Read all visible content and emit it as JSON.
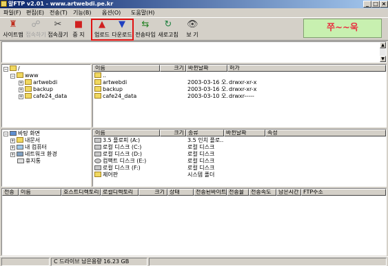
{
  "window": {
    "title": "알FTP v2.01 - www.artwebdi.pe.kr"
  },
  "menu": [
    "파일(F)",
    "편집(E)",
    "전송(T)",
    "기능(B)",
    "옵션(O)",
    "도움말(H)"
  ],
  "toolbar": {
    "site_manager": "사이트맵",
    "connect": "접속하기",
    "disconnect": "접속끊기",
    "stop": "중 지",
    "upload": "업로드",
    "download": "다운로드",
    "transfer_type": "전송타입",
    "refresh": "새로고침",
    "view": "보 기"
  },
  "logo_text": "쭈~~욱",
  "remote": {
    "tree": {
      "root": "/",
      "www": "www",
      "items": [
        "artwebdi",
        "backup",
        "cafe24_data"
      ]
    },
    "columns": [
      "이름",
      "크기",
      "바뀐날짜",
      "허가"
    ],
    "rows": [
      {
        "name": "..",
        "size": "",
        "date": "",
        "perm": ""
      },
      {
        "name": "artwebdi",
        "size": "",
        "date": "2003-03-16 오...",
        "perm": "drwxr-xr-x"
      },
      {
        "name": "backup",
        "size": "",
        "date": "2003-03-16 오...",
        "perm": "drwxr-xr-x"
      },
      {
        "name": "cafe24_data",
        "size": "",
        "date": "2003-03-10 오...",
        "perm": "drwxr-----"
      }
    ]
  },
  "local": {
    "tree": {
      "root": "바탕 화면",
      "items": [
        "내문서",
        "내 컴퓨터",
        "네트워크 환경",
        "휴지통"
      ]
    },
    "columns": [
      "이름",
      "크기",
      "종류",
      "바뀐날짜",
      "속성"
    ],
    "rows": [
      {
        "name": "3.5 플로피 (A:)",
        "type": "3.5 인치 플로..."
      },
      {
        "name": "로컬 디스크 (C:)",
        "type": "로컬 디스크"
      },
      {
        "name": "로컬 디스크 (D:)",
        "type": "로컬 디스크"
      },
      {
        "name": "컴팩트 디스크 (E:)",
        "type": "로컬 디스크"
      },
      {
        "name": "로컬 디스크 (F:)",
        "type": "로컬 디스크"
      },
      {
        "name": "제어판",
        "type": "시스템 폴더"
      }
    ]
  },
  "queue": {
    "columns": [
      "전송",
      "이름",
      "호스트디렉토리",
      "로컬디렉토리",
      "크기",
      "상태",
      "전송된바이트",
      "전송율",
      "전송속도",
      "남은시간",
      "FTP주소"
    ]
  },
  "status": {
    "disk_free": "C 드라이브 남은용량 16.23 GB"
  }
}
